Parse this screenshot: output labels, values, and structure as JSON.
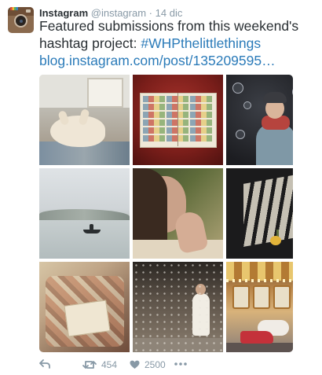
{
  "tweet": {
    "display_name": "Instagram",
    "handle": "@instagram",
    "separator": "·",
    "date": "14 dic",
    "text_line1": "Featured submissions from this weekend's",
    "text_line2_prefix": "hashtag project: ",
    "hashtag": "#WHPthelittlethings",
    "link": "blog.instagram.com/post/135209595…"
  },
  "actions": {
    "reply_icon": "reply-icon",
    "retweet_icon": "retweet-icon",
    "retweet_count": "454",
    "like_icon": "heart-icon",
    "like_count": "2500",
    "more_icon": "more-dots-icon"
  },
  "colors": {
    "link": "#2b7bb9",
    "text": "#292f33",
    "muted": "#8899a6"
  }
}
